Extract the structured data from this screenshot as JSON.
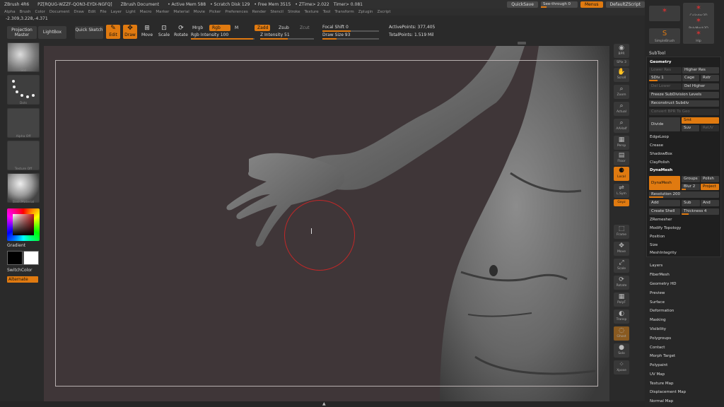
{
  "title_bar": {
    "app": "ZBrush 4R6",
    "build": "PZ[RQUG-WZZF-QON3-EYDI-NGFQ]",
    "document": "ZBrush Document",
    "stats": [
      "• Active Mem 588",
      "• Scratch Disk 129",
      "• Free Mem 3515",
      "• ZTime> 2.022",
      "Timer> 0.081"
    ],
    "quicksave": "QuickSave",
    "see_through": "See-through  0",
    "menus_btn": "Menus",
    "script_btn": "DefaultZScript"
  },
  "menu_bar": [
    "Alpha",
    "Brush",
    "Color",
    "Document",
    "Draw",
    "Edit",
    "File",
    "Layer",
    "Light",
    "Macro",
    "Marker",
    "Material",
    "Movie",
    "Picker",
    "Preferences",
    "Render",
    "Stencil",
    "Stroke",
    "Texture",
    "Tool",
    "Transform",
    "Zplugin",
    "Zscript"
  ],
  "coords": "-2.309,3.228,-4.371",
  "toolbar": {
    "projection_master": "Projection Master",
    "lightbox": "LightBox",
    "quick_sketch": "Quick Sketch",
    "edit": "Edit",
    "draw": "Draw",
    "move": "Move",
    "scale": "Scale",
    "rotate": "Rotate",
    "mrgb": "Mrgb",
    "rgb": "Rgb",
    "m": "M",
    "rgb_intensity": "Rgb Intensity 100",
    "zadd": "Zadd",
    "zsub": "Zsub",
    "zcut": "Zcut",
    "z_intensity": "Z Intensity 51",
    "focal_shift": "Focal Shift 0",
    "draw_size": "Draw Size 93",
    "active_points": "ActivePoints: 377,405",
    "total_points": "TotalPoints: 1.519 Mil"
  },
  "left_panel": {
    "brush_label": "Std",
    "stroke_label": "Dots",
    "alpha_label": "Alpha Off",
    "texture_label": "Texture Off",
    "material_label": "BasicMaterial",
    "gradient": "Gradient",
    "switch_color": "SwitchColor",
    "alternate": "Alternate",
    "main_color": "#ffffff",
    "secondary_color": "#000000"
  },
  "right_tools": [
    "BPR",
    "SPix 3",
    "Scroll",
    "Zoom",
    "Actual",
    "AAHalf",
    "Persp",
    "Floor",
    "Local",
    "L.Sym",
    "Gxyz",
    "Frame",
    "Move",
    "Scale",
    "Rotate",
    "PolyF",
    "Transp",
    "Ghost",
    "Solo",
    "Xpose"
  ],
  "right_panel": {
    "brush_thumbs": [
      "Cylinder3D",
      "PolyMesh3D",
      "SimpleBrush",
      "Hip"
    ],
    "subtool": "SubTool",
    "geometry": "Geometry",
    "lower_res": "Lower Res",
    "higher_res": "Higher Res",
    "sdiv": "SDiv 1",
    "cage": "Cage",
    "rstr": "Rstr",
    "del_lower": "Del Lower",
    "del_higher": "Del Higher",
    "freeze_subdivision": "Freeze SubDivision Levels",
    "reconstruct_subdiv": "Reconstruct Subdiv",
    "convert_bpr": "Convert BPR To Geo",
    "divide": "Divide",
    "smt": "Smt",
    "suv": "Suv",
    "reuv": "ReUV",
    "edgeloop": "EdgeLoop",
    "crease": "Crease",
    "shadowbox": "ShadowBox",
    "claypolish": "ClayPolish",
    "dynamesh_title": "DynaMesh",
    "dynamesh_btn": "DynaMesh",
    "groups": "Groups",
    "polish": "Polish",
    "blur": "Blur 2",
    "project": "Project",
    "resolution": "Resolution 200",
    "add": "Add",
    "sub": "Sub",
    "and": "And",
    "create_shell": "Create Shell",
    "thickness": "Thickness 4",
    "zremesher": "ZRemesher",
    "modify_topology": "Modify Topology",
    "position": "Position",
    "size": "Size",
    "meshintegrity": "MeshIntegrity",
    "subpalettes": [
      "Layers",
      "FiberMesh",
      "Geometry HD",
      "Preview",
      "Surface",
      "Deformation",
      "Masking",
      "Visibility",
      "Polygroups",
      "Contact",
      "Morph Target",
      "Polypaint",
      "UV Map",
      "Texture Map",
      "Displacement Map",
      "Normal Map"
    ]
  },
  "colors": {
    "accent": "#e07a10",
    "canvas": "#3f3638",
    "brush_ring": "#c02828"
  }
}
